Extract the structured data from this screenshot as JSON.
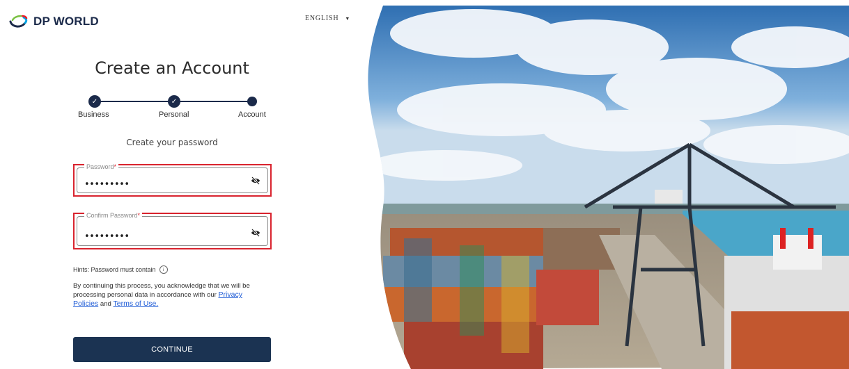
{
  "brand": {
    "name": "DP WORLD",
    "accent": "#1b2a4a",
    "swoosh_colors": [
      "#7ac143",
      "#00a4e4",
      "#ed1c24"
    ]
  },
  "language": {
    "selected": "ENGLISH"
  },
  "form": {
    "title": "Create an Account",
    "steps": [
      {
        "label": "Business",
        "status": "completed"
      },
      {
        "label": "Personal",
        "status": "completed"
      },
      {
        "label": "Account",
        "status": "current"
      }
    ],
    "subtitle": "Create your password",
    "password": {
      "label": "Password",
      "required_mark": "*",
      "value": "•••••••••"
    },
    "confirm_password": {
      "label": "Confirm Password",
      "required_mark": "*",
      "value": "•••••••••"
    },
    "hints_label": "Hints: Password must contain",
    "legal": {
      "text": "By continuing this process, you acknowledge that we will be processing personal data in accordance with our",
      "privacy_link": "Privacy Policies",
      "and": "and",
      "terms_link": "Terms of Use."
    },
    "continue_label": "CONTINUE"
  },
  "colors": {
    "button": "#1b3352",
    "error_outline": "#d9232e",
    "link": "#1e5bd6"
  },
  "hero": {
    "description_icon": "port-container-terminal-photo"
  }
}
